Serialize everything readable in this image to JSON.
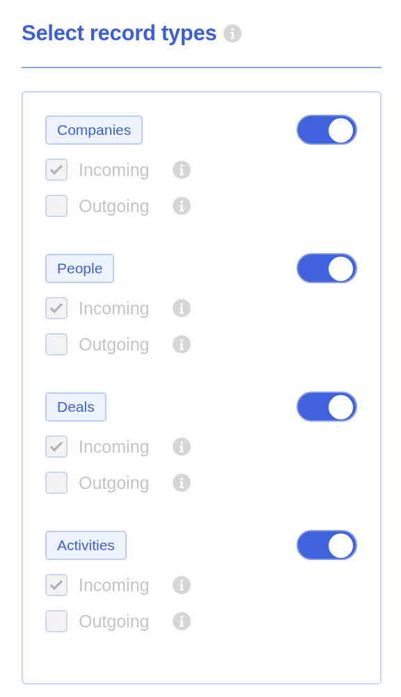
{
  "title": "Select record types",
  "record_types": [
    {
      "label": "Companies",
      "on": true,
      "options": [
        {
          "label": "Incoming",
          "checked": true,
          "disabled": true
        },
        {
          "label": "Outgoing",
          "checked": false,
          "disabled": true
        }
      ]
    },
    {
      "label": "People",
      "on": true,
      "options": [
        {
          "label": "Incoming",
          "checked": true,
          "disabled": true
        },
        {
          "label": "Outgoing",
          "checked": false,
          "disabled": true
        }
      ]
    },
    {
      "label": "Deals",
      "on": true,
      "options": [
        {
          "label": "Incoming",
          "checked": true,
          "disabled": true
        },
        {
          "label": "Outgoing",
          "checked": false,
          "disabled": true
        }
      ]
    },
    {
      "label": "Activities",
      "on": true,
      "options": [
        {
          "label": "Incoming",
          "checked": true,
          "disabled": true
        },
        {
          "label": "Outgoing",
          "checked": false,
          "disabled": true
        }
      ]
    }
  ]
}
